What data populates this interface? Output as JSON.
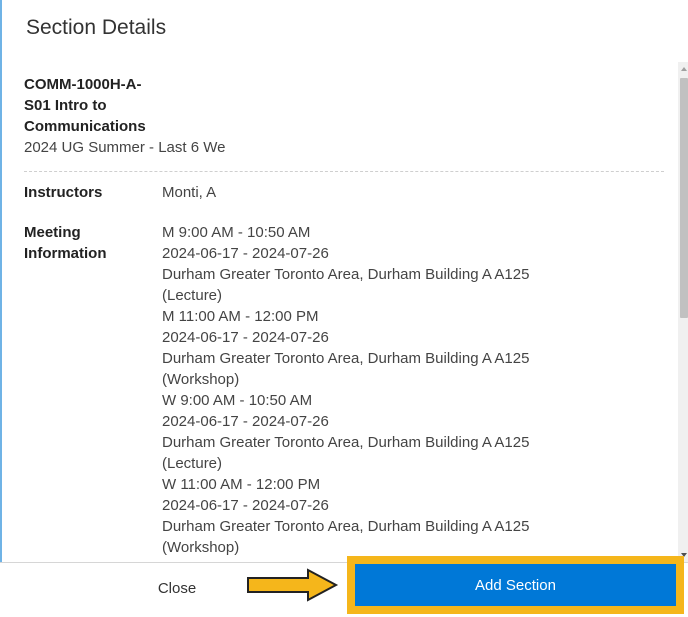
{
  "dialog": {
    "title": "Section Details",
    "course_code_line1": "COMM-1000H-A-",
    "course_code_line2": "S01 Intro to",
    "course_code_line3": "Communications",
    "term": "2024 UG Summer - Last 6 We"
  },
  "instructors": {
    "label": "Instructors",
    "value": "Monti, A"
  },
  "meeting": {
    "label_line1": "Meeting",
    "label_line2": "Information",
    "lines": [
      "M 9:00 AM - 10:50 AM",
      "2024-06-17 - 2024-07-26",
      "Durham Greater Toronto Area, Durham Building A A125",
      "(Lecture)",
      "M 11:00 AM - 12:00 PM",
      "2024-06-17 - 2024-07-26",
      "Durham Greater Toronto Area, Durham Building A A125",
      "(Workshop)",
      "W 9:00 AM - 10:50 AM",
      "2024-06-17 - 2024-07-26",
      "Durham Greater Toronto Area, Durham Building A A125",
      "(Lecture)",
      "W 11:00 AM - 12:00 PM",
      "2024-06-17 - 2024-07-26",
      "Durham Greater Toronto Area, Durham Building A A125",
      "(Workshop)"
    ]
  },
  "footer": {
    "close_label": "Close",
    "add_label": "Add Section"
  },
  "colors": {
    "primary": "#0078d7",
    "highlight": "#f5b61b"
  }
}
